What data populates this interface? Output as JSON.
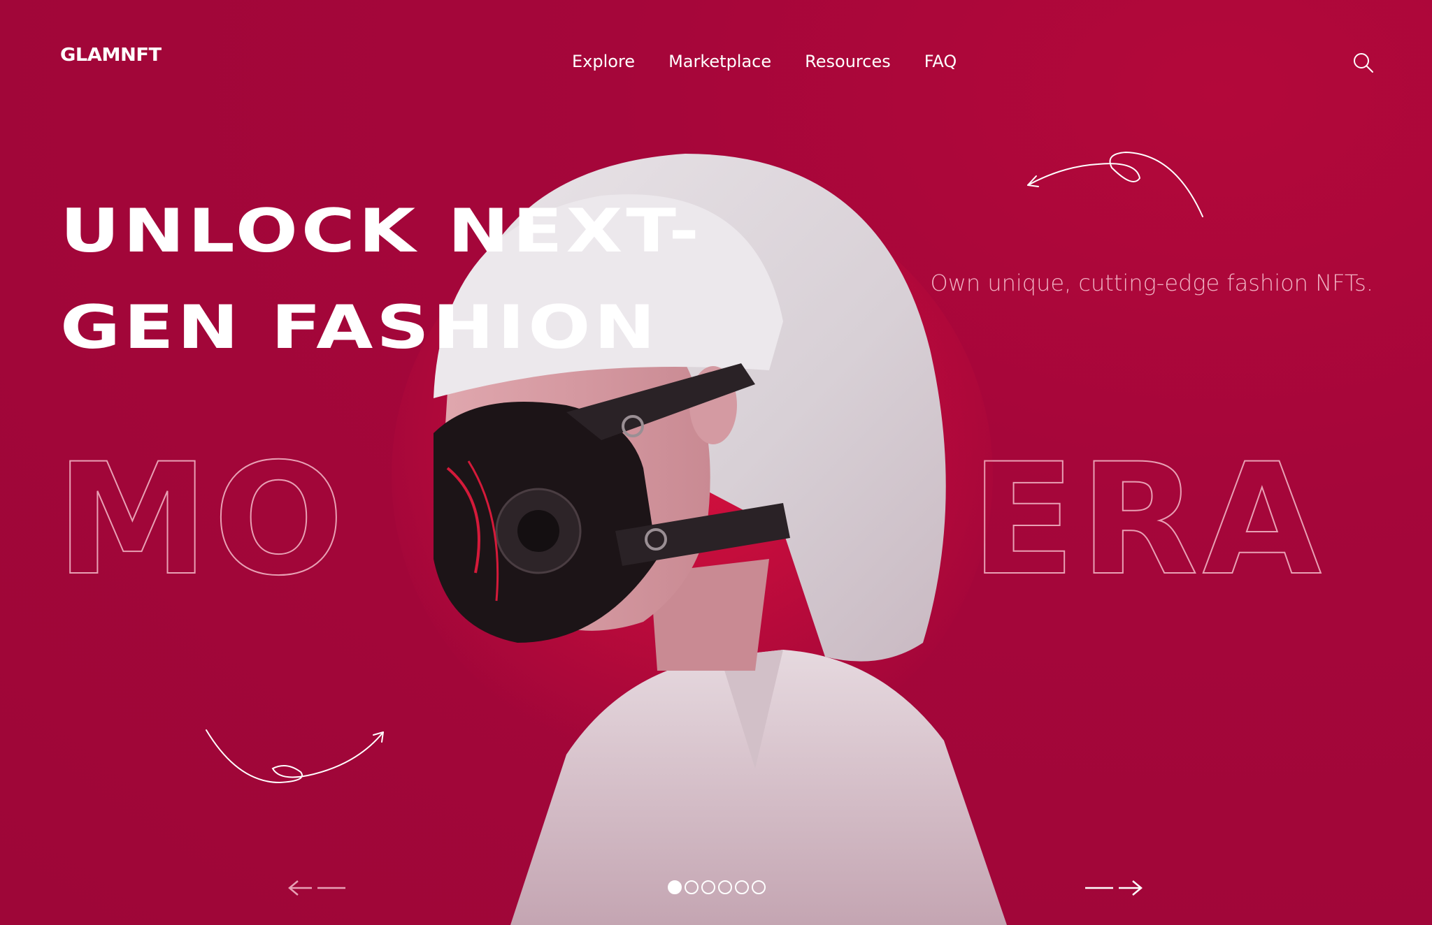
{
  "brand": {
    "logo_text": "GLAMNFT"
  },
  "nav": {
    "items": [
      {
        "label": "Explore"
      },
      {
        "label": "Marketplace"
      },
      {
        "label": "Resources"
      },
      {
        "label": "FAQ"
      }
    ]
  },
  "hero": {
    "title_line_1": "UNLOCK NEXT-",
    "title_line_2": "GEN FASHION",
    "tagline": "Own unique, cutting-edge fashion NFTs.",
    "background_word_left": "MO",
    "background_word_right": "ERA"
  },
  "carousel": {
    "slide_count": 6,
    "active_index": 0
  },
  "colors": {
    "background": "#a5063a",
    "text": "#ffffff",
    "tagline": "#f1b3c4"
  },
  "icons": {
    "search": "search-icon",
    "prev": "arrow-left-icon",
    "next": "arrow-right-icon"
  }
}
